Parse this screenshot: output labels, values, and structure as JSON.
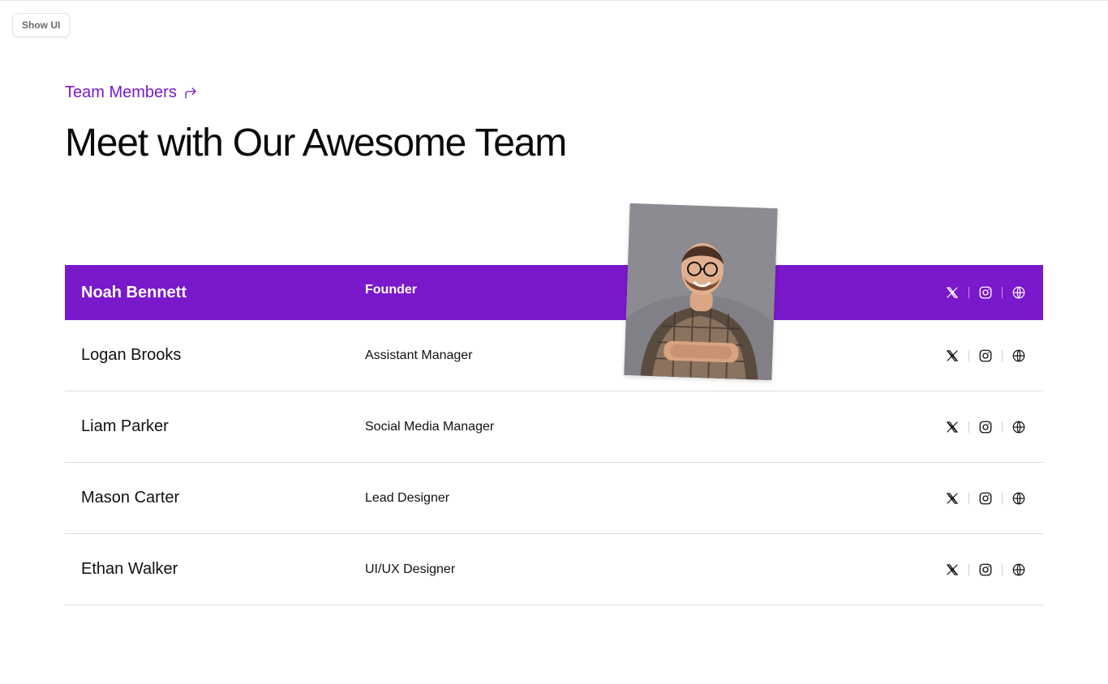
{
  "toolbar": {
    "show_ui_label": "Show UI"
  },
  "header": {
    "eyebrow": "Team Members",
    "title": "Meet with Our Awesome Team"
  },
  "team": {
    "members": [
      {
        "name": "Noah Bennett",
        "role": "Founder",
        "active": true
      },
      {
        "name": "Logan Brooks",
        "role": "Assistant Manager",
        "active": false
      },
      {
        "name": "Liam Parker",
        "role": "Social Media Manager",
        "active": false
      },
      {
        "name": "Mason Carter",
        "role": "Lead Designer",
        "active": false
      },
      {
        "name": "Ethan Walker",
        "role": "UI/UX Designer",
        "active": false
      }
    ]
  },
  "icons": {
    "social": [
      "x-icon",
      "instagram-icon",
      "globe-icon"
    ],
    "eyebrow": "arrow-turn-right-icon"
  },
  "colors": {
    "accent": "#7a18cc",
    "text": "#0b0b0b",
    "divider": "#dcdcdc"
  }
}
